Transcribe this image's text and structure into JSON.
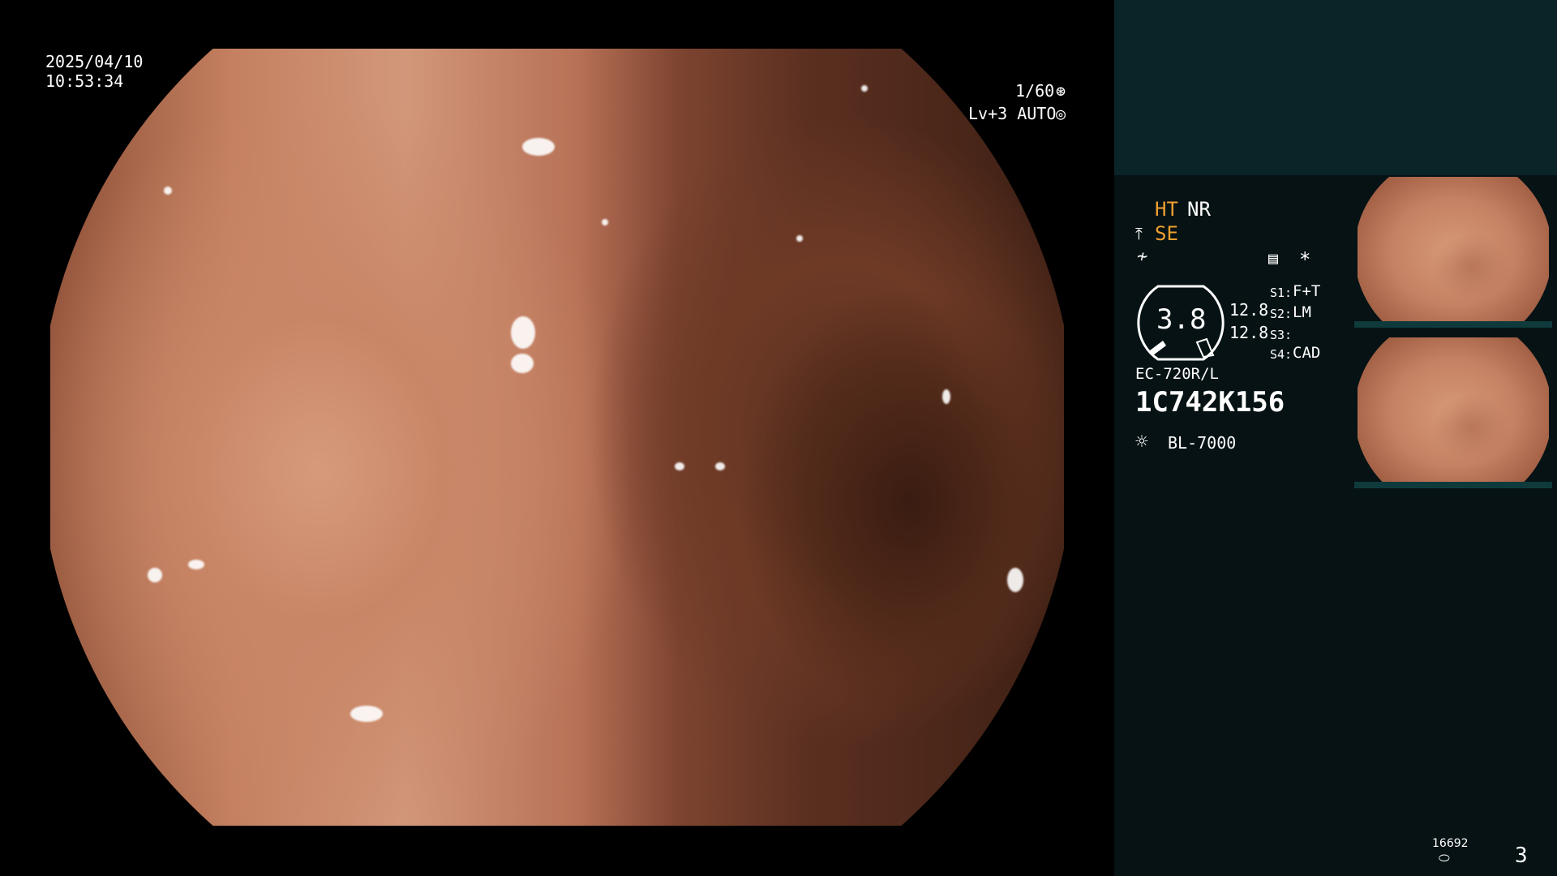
{
  "overlay": {
    "date": "2025/04/10",
    "time": "10:53:34",
    "shutter": "1/60",
    "shutter_icon": "iris-icon",
    "level": "Lv+3 AUTO",
    "level_icon": "auto-exposure-icon"
  },
  "status": {
    "ht": "HT",
    "nr": "NR",
    "se": "SE",
    "se_icon": "structure-enhance-icon",
    "f_icon": "f-mode-icon",
    "mode_icon": "menu-icon",
    "asterisk": "*",
    "zoom": "3.8",
    "value_a": "12.8",
    "value_b": "12.8",
    "s1_key": "S1:",
    "s1_val": "F+T",
    "s2_key": "S2:",
    "s2_val": "LM",
    "s3_key": "S3:",
    "s3_val": "",
    "s4_key": "S4:",
    "s4_val": "CAD",
    "scope_model": "EC-720R/L",
    "serial": "1C742K156",
    "light_source": "BL-7000",
    "light_icon": "light-source-icon"
  },
  "footer": {
    "storage_count": "16692",
    "storage_icon": "storage-icon",
    "page_number": "3"
  },
  "colors": {
    "accent_orange": "#f0a030",
    "panel_bg": "#061214",
    "panel_top": "#0a2427"
  }
}
